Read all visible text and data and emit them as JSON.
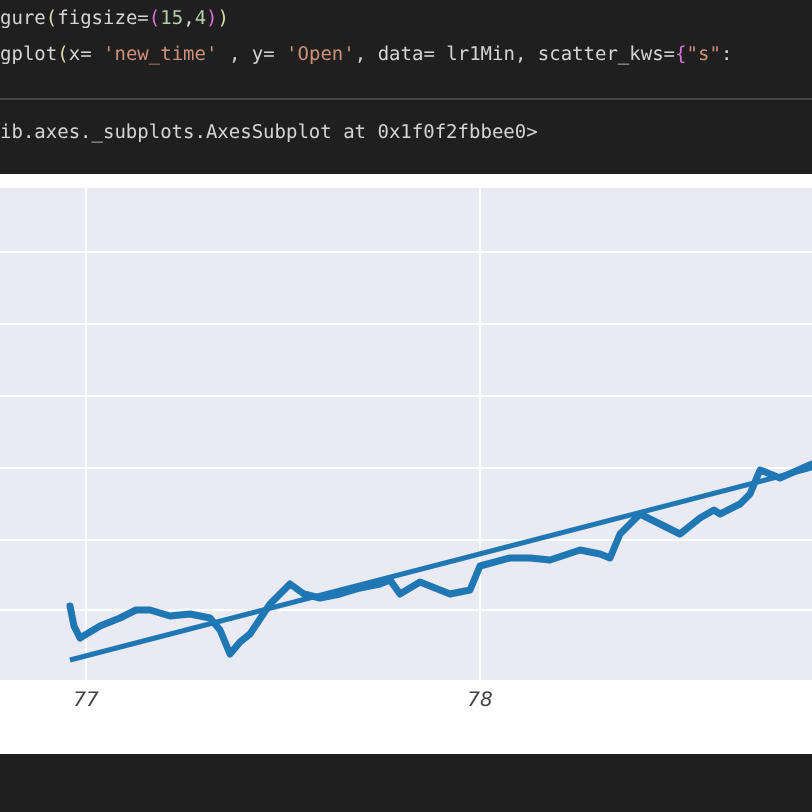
{
  "code_cell": {
    "lines": [
      [
        {
          "kind": "plain",
          "text": "gure"
        },
        {
          "kind": "paren",
          "text": "("
        },
        {
          "kind": "plain",
          "text": "figsize="
        },
        {
          "kind": "bracket",
          "text": "("
        },
        {
          "kind": "number",
          "text": "15"
        },
        {
          "kind": "plain",
          "text": ","
        },
        {
          "kind": "number",
          "text": "4"
        },
        {
          "kind": "bracket",
          "text": ")"
        },
        {
          "kind": "paren",
          "text": ")"
        }
      ],
      [
        {
          "kind": "plain",
          "text": "gplot"
        },
        {
          "kind": "paren",
          "text": "("
        },
        {
          "kind": "plain",
          "text": "x= "
        },
        {
          "kind": "string",
          "text": "'new_time'"
        },
        {
          "kind": "plain",
          "text": " , y= "
        },
        {
          "kind": "string",
          "text": "'Open'"
        },
        {
          "kind": "plain",
          "text": ", data= lr1Min, scatter_kws="
        },
        {
          "kind": "bracket",
          "text": "{"
        },
        {
          "kind": "string",
          "text": "\"s\""
        },
        {
          "kind": "plain",
          "text": ":"
        }
      ]
    ]
  },
  "output": {
    "text": "ib.axes._subplots.AxesSubplot at 0x1f0f2fbbee0>"
  },
  "plot": {
    "kind": "picture",
    "x_tick_labels": [
      "77",
      "78"
    ]
  }
}
